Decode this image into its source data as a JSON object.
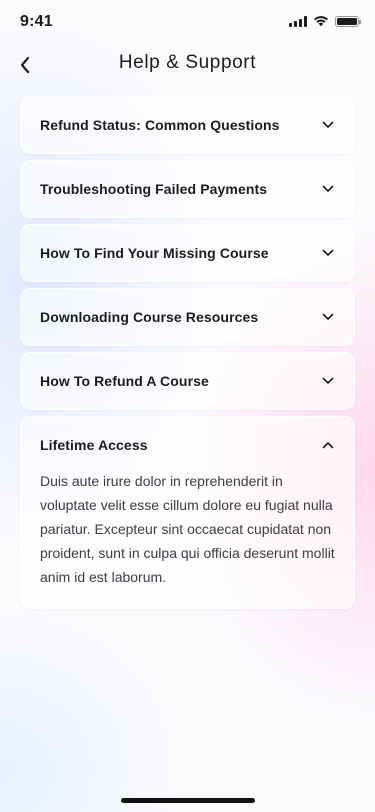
{
  "status_bar": {
    "time": "9:41",
    "icons": [
      "signal-icon",
      "wifi-icon",
      "battery-icon"
    ]
  },
  "header": {
    "title": "Help & Support",
    "back_icon": "chevron-left-icon"
  },
  "faq": {
    "items": [
      {
        "question": "Refund Status: Common Questions",
        "expanded": false
      },
      {
        "question": "Troubleshooting Failed Payments",
        "expanded": false
      },
      {
        "question": "How To Find Your Missing Course",
        "expanded": false
      },
      {
        "question": "Downloading Course Resources",
        "expanded": false
      },
      {
        "question": "How To Refund A Course",
        "expanded": false
      },
      {
        "question": "Lifetime Access",
        "expanded": true,
        "answer": "Duis aute irure dolor in reprehenderit in voluptate velit esse cillum dolore eu fugiat nulla pariatur. Excepteur sint occaecat cupidatat non proident, sunt in culpa qui officia deserunt mollit anim id est laborum."
      }
    ]
  }
}
